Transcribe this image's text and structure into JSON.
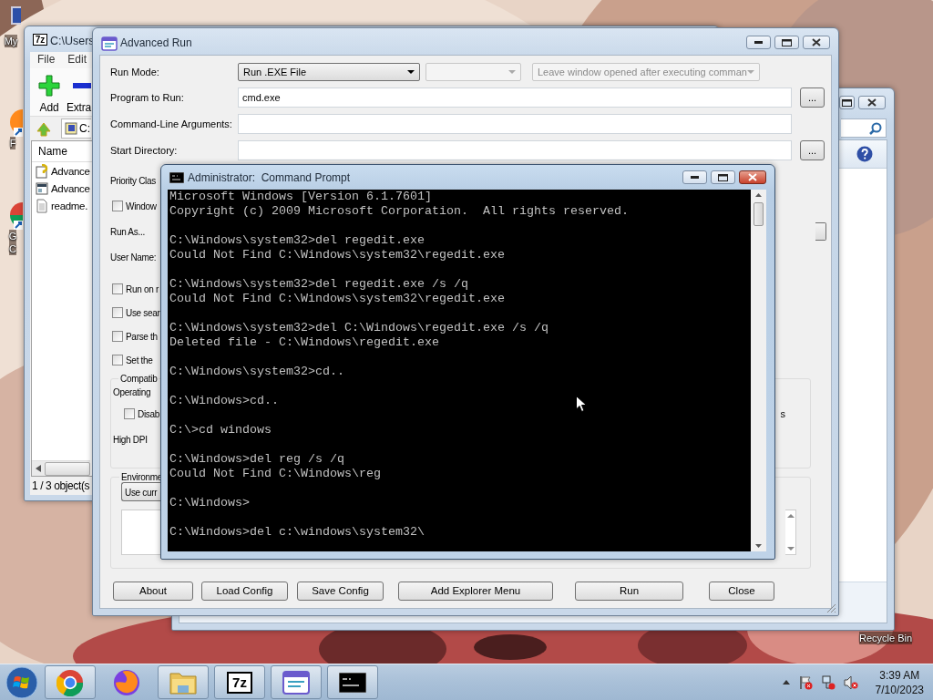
{
  "desktop": {
    "kind": "picture",
    "icons": [
      {
        "kind": "computer",
        "lines": [
          "My"
        ]
      },
      {
        "kind": "firefox",
        "lines": [
          "F"
        ]
      },
      {
        "kind": "chrome",
        "lines": [
          "G",
          "C"
        ]
      },
      {
        "kind": "recycle",
        "lines": [
          "Recycle Bin"
        ]
      }
    ]
  },
  "sevenzip_window": {
    "title": "C:\\Users",
    "logo": "7z",
    "menu": [
      "File",
      "Edit"
    ],
    "toolbar": [
      "Add",
      "Extra"
    ],
    "address": "C:",
    "columns": [
      "Name"
    ],
    "files": [
      {
        "kind": "help",
        "name": "Advance"
      },
      {
        "kind": "app",
        "name": "Advance"
      },
      {
        "kind": "text",
        "name": "readme."
      }
    ],
    "status": "1 / 3 object(s"
  },
  "advanced_run": {
    "title": "Advanced Run",
    "run_mode": {
      "label": "Run Mode:",
      "value": "Run .EXE File",
      "option": "Leave window opened after executing comman"
    },
    "fields": [
      {
        "label": "Program to Run:",
        "value": "cmd.exe",
        "browse": "..."
      },
      {
        "label": "Command-Line Arguments:"
      },
      {
        "label": "Start Directory:",
        "browse": "..."
      }
    ],
    "rows": [
      {
        "kind": "label",
        "text": "Priority Clas"
      },
      {
        "kind": "checkbox",
        "text": "Window",
        "checked": false
      },
      {
        "kind": "dropdown",
        "text": "Run As..."
      },
      {
        "kind": "label",
        "text": "User Name:"
      },
      {
        "kind": "checkbox",
        "text": "Run on r",
        "checked": false
      },
      {
        "kind": "checkbox",
        "text": "Use sear",
        "checked": false
      },
      {
        "kind": "checkbox",
        "text": "Parse th",
        "checked": false
      },
      {
        "kind": "checkbox",
        "text": "Set the",
        "checked": false
      }
    ],
    "compatibility": {
      "title": "Compatib",
      "operating": "Operating",
      "checkbox": {
        "text": "Disab",
        "checked": false
      },
      "trailing": "s",
      "high_dpi": "High DPI"
    },
    "environment": {
      "title": "Environme",
      "button": "Use curr"
    },
    "buttons": [
      "About",
      "Load Config",
      "Save Config",
      "Add Explorer Menu",
      "Run",
      "Close"
    ]
  },
  "cmd": {
    "title": "Administrator:  Command Prompt",
    "blocks": [
      [
        "Microsoft Windows [Version 6.1.7601]",
        "Copyright (c) 2009 Microsoft Corporation.  All rights reserved."
      ],
      [
        "C:\\Windows\\system32>del regedit.exe",
        "Could Not Find C:\\Windows\\system32\\regedit.exe"
      ],
      [
        "C:\\Windows\\system32>del regedit.exe /s /q",
        "Could Not Find C:\\Windows\\system32\\regedit.exe"
      ],
      [
        "C:\\Windows\\system32>del C:\\Windows\\regedit.exe /s /q",
        "Deleted file - C:\\Windows\\regedit.exe"
      ],
      [
        "C:\\Windows\\system32>cd.."
      ],
      [
        "C:\\Windows>cd.."
      ],
      [
        "C:\\>cd windows"
      ],
      [
        "C:\\Windows>del reg /s /q",
        "Could Not Find C:\\Windows\\reg"
      ],
      [
        "C:\\Windows>"
      ],
      [
        "C:\\Windows>del c:\\windows\\system32\\"
      ]
    ]
  },
  "taskbar": {
    "items": [
      {
        "kind": "chrome",
        "running": true
      },
      {
        "kind": "firefox",
        "running": false
      },
      {
        "kind": "explorer",
        "running": true
      },
      {
        "kind": "sevenzip",
        "label": "7z",
        "running": true
      },
      {
        "kind": "advrun",
        "running": true
      },
      {
        "kind": "cmd",
        "running": true
      }
    ],
    "time": "3:39 AM",
    "date": "7/10/2023"
  }
}
